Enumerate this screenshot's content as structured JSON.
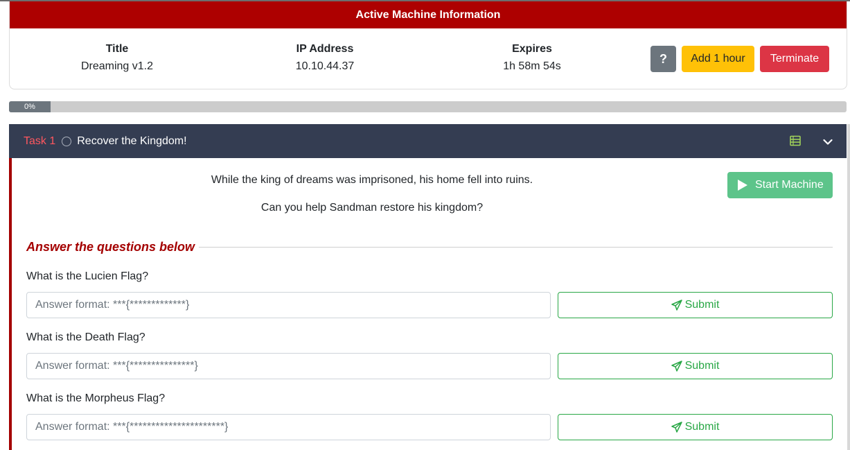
{
  "machine": {
    "header": "Active Machine Information",
    "title_label": "Title",
    "title_value": "Dreaming v1.2",
    "ip_label": "IP Address",
    "ip_value": "10.10.44.37",
    "expires_label": "Expires",
    "expires_value": "1h 58m 54s",
    "help_label": "?",
    "add_hour_label": "Add 1 hour",
    "terminate_label": "Terminate"
  },
  "progress": {
    "label": "0%",
    "value": 0
  },
  "task": {
    "number": "Task 1",
    "title": "Recover the Kingdom!",
    "description_1": "While the king of dreams was imprisoned, his home fell into ruins.",
    "description_2": "Can you help Sandman restore his kingdom?",
    "start_machine_label": "Start Machine",
    "answer_heading": "Answer the questions below",
    "questions": [
      {
        "text": "What is the Lucien Flag?",
        "placeholder": "Answer format: ***{*************}",
        "submit": "Submit"
      },
      {
        "text": "What is the Death Flag?",
        "placeholder": "Answer format: ***{***************}",
        "submit": "Submit"
      },
      {
        "text": "What is the Morpheus Flag?",
        "placeholder": "Answer format: ***{**********************}",
        "submit": "Submit"
      }
    ]
  },
  "colors": {
    "header_red": "#ad0000",
    "task_header": "#343d52",
    "start_green": "#5dc48a",
    "submit_green": "#28a745",
    "add_yellow": "#ffc107",
    "terminate_red": "#dc3545"
  },
  "icons": [
    "question-mark",
    "list-icon",
    "chevron-down-icon",
    "play-icon",
    "paper-plane-icon",
    "circle-status-icon"
  ]
}
